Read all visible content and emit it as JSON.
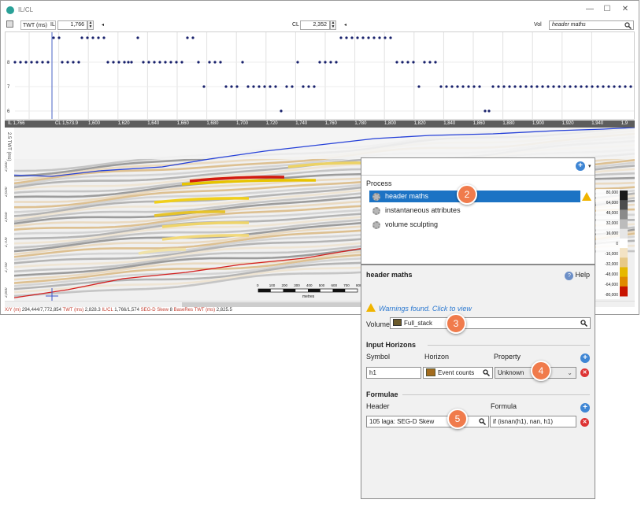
{
  "window": {
    "title": "IL/CL",
    "minimize": "—",
    "maximize": "☐",
    "close": "✕"
  },
  "toolbar": {
    "axis_mode": "TWT (ms)",
    "il_label": "IL",
    "il_value": "1,766",
    "cl_label": "CL",
    "cl_value": "2,352",
    "vol_label": "Vol",
    "vol_value": "header maths"
  },
  "strip": {
    "y_ticks": [
      "8",
      "7",
      "6",
      "5"
    ],
    "points": [
      [
        4,
        1
      ],
      [
        11,
        1
      ],
      [
        18,
        1
      ],
      [
        25,
        1
      ],
      [
        32,
        1
      ],
      [
        39,
        1
      ],
      [
        46,
        1
      ],
      [
        53,
        2
      ],
      [
        60,
        2
      ],
      [
        64,
        1
      ],
      [
        71,
        1
      ],
      [
        78,
        1
      ],
      [
        85,
        1
      ],
      [
        89,
        2
      ],
      [
        96,
        2
      ],
      [
        103,
        2
      ],
      [
        110,
        2
      ],
      [
        117,
        2
      ],
      [
        122,
        1
      ],
      [
        129,
        1
      ],
      [
        136,
        1
      ],
      [
        143,
        1
      ],
      [
        148,
        1
      ],
      [
        152,
        1
      ],
      [
        160,
        2
      ],
      [
        167,
        1
      ],
      [
        174,
        1
      ],
      [
        181,
        1
      ],
      [
        188,
        1
      ],
      [
        195,
        1
      ],
      [
        202,
        1
      ],
      [
        209,
        1
      ],
      [
        216,
        1
      ],
      [
        223,
        2
      ],
      [
        230,
        2
      ],
      [
        237,
        1
      ],
      [
        244,
        0
      ],
      [
        251,
        1
      ],
      [
        258,
        1
      ],
      [
        265,
        1
      ],
      [
        272,
        0
      ],
      [
        279,
        0
      ],
      [
        286,
        0
      ],
      [
        293,
        1
      ],
      [
        300,
        0
      ],
      [
        307,
        0
      ],
      [
        314,
        0
      ],
      [
        321,
        0
      ],
      [
        328,
        0
      ],
      [
        335,
        0
      ],
      [
        342,
        -1
      ],
      [
        349,
        0
      ],
      [
        356,
        0
      ],
      [
        363,
        1
      ],
      [
        370,
        0
      ],
      [
        377,
        0
      ],
      [
        384,
        0
      ],
      [
        391,
        1
      ],
      [
        398,
        1
      ],
      [
        405,
        1
      ],
      [
        412,
        1
      ],
      [
        418,
        2
      ],
      [
        425,
        2
      ],
      [
        432,
        2
      ],
      [
        439,
        2
      ],
      [
        446,
        2
      ],
      [
        453,
        2
      ],
      [
        460,
        2
      ],
      [
        467,
        2
      ],
      [
        474,
        2
      ],
      [
        481,
        2
      ],
      [
        489,
        1
      ],
      [
        496,
        1
      ],
      [
        503,
        1
      ],
      [
        510,
        1
      ],
      [
        517,
        0
      ],
      [
        524,
        1
      ],
      [
        531,
        1
      ],
      [
        538,
        1
      ],
      [
        545,
        0
      ],
      [
        552,
        0
      ],
      [
        559,
        0
      ],
      [
        566,
        0
      ],
      [
        573,
        0
      ],
      [
        580,
        0
      ],
      [
        587,
        0
      ],
      [
        594,
        0
      ],
      [
        601,
        -1
      ],
      [
        606,
        -1
      ],
      [
        611,
        0
      ],
      [
        618,
        0
      ],
      [
        625,
        0
      ],
      [
        632,
        0
      ],
      [
        639,
        0
      ],
      [
        646,
        0
      ],
      [
        653,
        0
      ],
      [
        660,
        0
      ],
      [
        667,
        0
      ],
      [
        674,
        0
      ],
      [
        681,
        0
      ],
      [
        688,
        0
      ],
      [
        695,
        0
      ],
      [
        702,
        0
      ],
      [
        709,
        0
      ],
      [
        716,
        0
      ],
      [
        723,
        0
      ],
      [
        730,
        0
      ],
      [
        737,
        0
      ],
      [
        744,
        0
      ],
      [
        751,
        0
      ],
      [
        758,
        0
      ],
      [
        765,
        0
      ],
      [
        772,
        0
      ],
      [
        779,
        0
      ],
      [
        786,
        0
      ]
    ]
  },
  "axis": {
    "il_tag": "IL 1,766",
    "cl_tag": "CL 1,573.9",
    "ticks": [
      "1,600",
      "1,620",
      "1,640",
      "1,660",
      "1,680",
      "1,700",
      "1,720",
      "1,740",
      "1,760",
      "1,780",
      "1,800",
      "1,820",
      "1,840",
      "1,860",
      "1,880",
      "1,900",
      "1,920",
      "1,940",
      "1,9"
    ]
  },
  "seismic": {
    "y_label": "2.5 TWT (ms)",
    "y_ticks": [
      "2,550",
      "2,600",
      "2,650",
      "2,700",
      "2,750",
      "2,800"
    ],
    "scale_ticks": [
      "0",
      "100",
      "200",
      "300",
      "400",
      "500",
      "600",
      "700",
      "800"
    ],
    "scale_unit": "metres"
  },
  "legend": {
    "values": [
      "80,000",
      "64,000",
      "48,000",
      "32,000",
      "16,000",
      "0",
      "-16,000",
      "-32,000",
      "-48,000",
      "-64,000",
      "-80,000"
    ]
  },
  "status": {
    "xy_label": "X/Y (m)",
    "xy_value": "294,444/7,772,854",
    "twt_label": "TWT (ms)",
    "twt_value": "2,828.3",
    "ilcl_label": "IL/CL",
    "ilcl_value": "1,766/1,574",
    "segd_label": "SEG-D Skew",
    "segd_value": "8",
    "baseres_label": "BaseRes TWT (ms)",
    "baseres_value": "2,825.5"
  },
  "process": {
    "header": "Process",
    "items": [
      "header maths",
      "instantaneous attributes",
      "volume sculpting"
    ]
  },
  "props": {
    "title": "header maths",
    "help": "Help",
    "warning": "Warnings found. Click to view",
    "volume_label": "Volume",
    "volume_value": "Full_stack",
    "input_horizons": "Input Horizons",
    "col_symbol": "Symbol",
    "col_horizon": "Horizon",
    "col_property": "Property",
    "symbol_value": "h1",
    "horizon_value": "Event counts",
    "property_value": "Unknown",
    "formulae": "Formulae",
    "col_header": "Header",
    "col_formula": "Formula",
    "header_value": "105 laga: SEG-D Skew",
    "formula_value": "if (isnan(h1), nan, h1)"
  },
  "callouts": [
    "2",
    "3",
    "4",
    "5"
  ]
}
